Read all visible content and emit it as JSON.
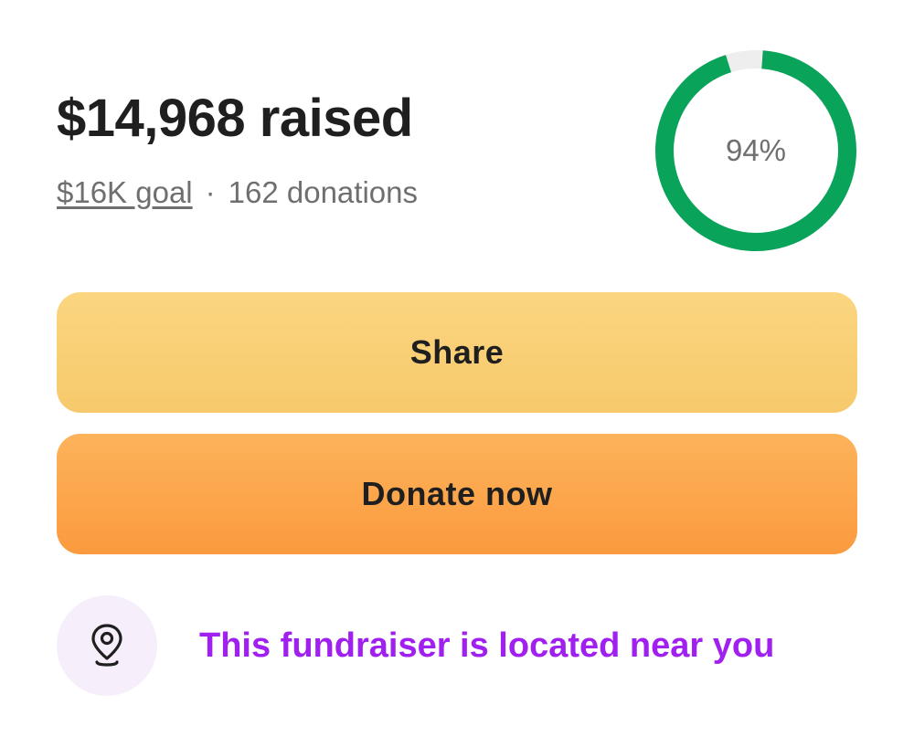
{
  "fundraiser": {
    "amount_raised": "$14,968 raised",
    "goal": "$16K goal",
    "separator": "·",
    "donations": "162 donations"
  },
  "progress": {
    "percent_label": "94%",
    "fraction": 0.94,
    "ring_color": "#0aa35a",
    "track_color": "#eeeeee"
  },
  "actions": {
    "share_label": "Share",
    "donate_label": "Donate now"
  },
  "location": {
    "icon": "map-pin-icon",
    "text": "This fundraiser is located near you",
    "text_color": "#a020f0"
  }
}
